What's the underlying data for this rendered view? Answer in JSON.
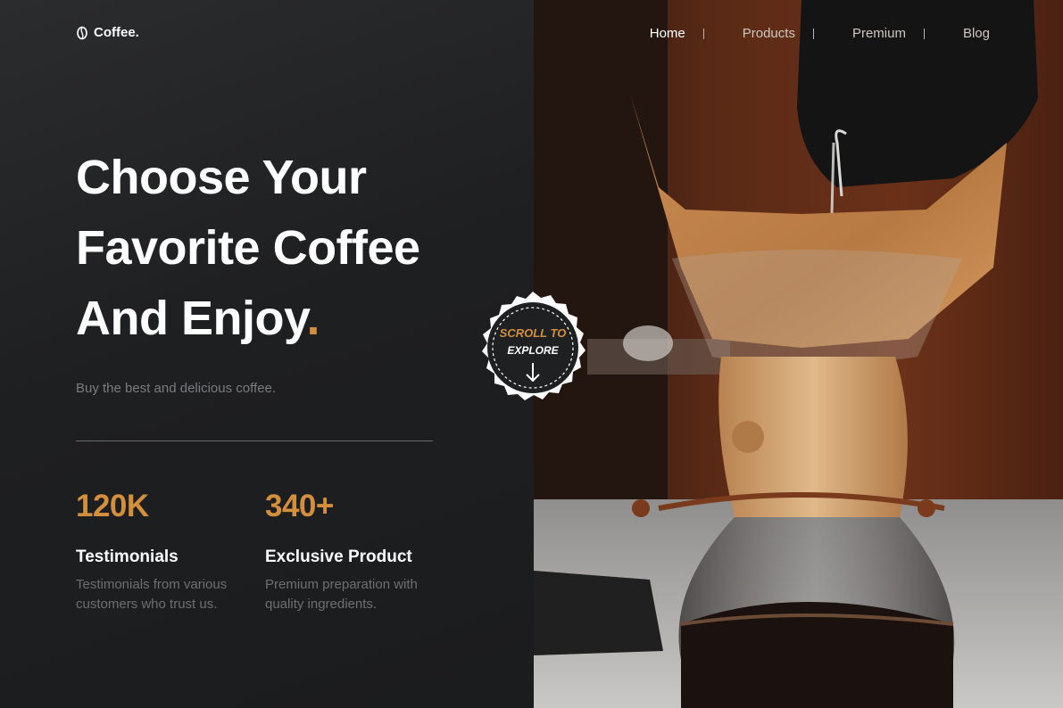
{
  "brand": {
    "name": "Coffee.",
    "icon": "coffee-bean-icon"
  },
  "nav": {
    "items": [
      "Home",
      "Products",
      "Premium",
      "Blog"
    ],
    "active": "Home"
  },
  "hero": {
    "line1": "Choose Your",
    "line2": "Favorite Coffee",
    "line3": "And Enjoy",
    "accent": ".",
    "subtitle": "Buy the best and delicious coffee."
  },
  "stats": [
    {
      "value": "120K",
      "title": "Testimonials",
      "desc1": "Testimonials from various",
      "desc2": "customers who trust us."
    },
    {
      "value": "340+",
      "title": "Exclusive Product",
      "desc1": "Premium preparation with",
      "desc2": "quality ingredients."
    }
  ],
  "badge": {
    "line1": "SCROLL TO",
    "line2": "EXPLORE",
    "icon": "arrow-down-icon"
  },
  "hero_image": {
    "subject": "pour-over coffee chemex"
  },
  "colors": {
    "accent": "#d48f3c",
    "panel": "#1e1f21",
    "text": "#ffffff",
    "muted": "#7b7c7e"
  }
}
